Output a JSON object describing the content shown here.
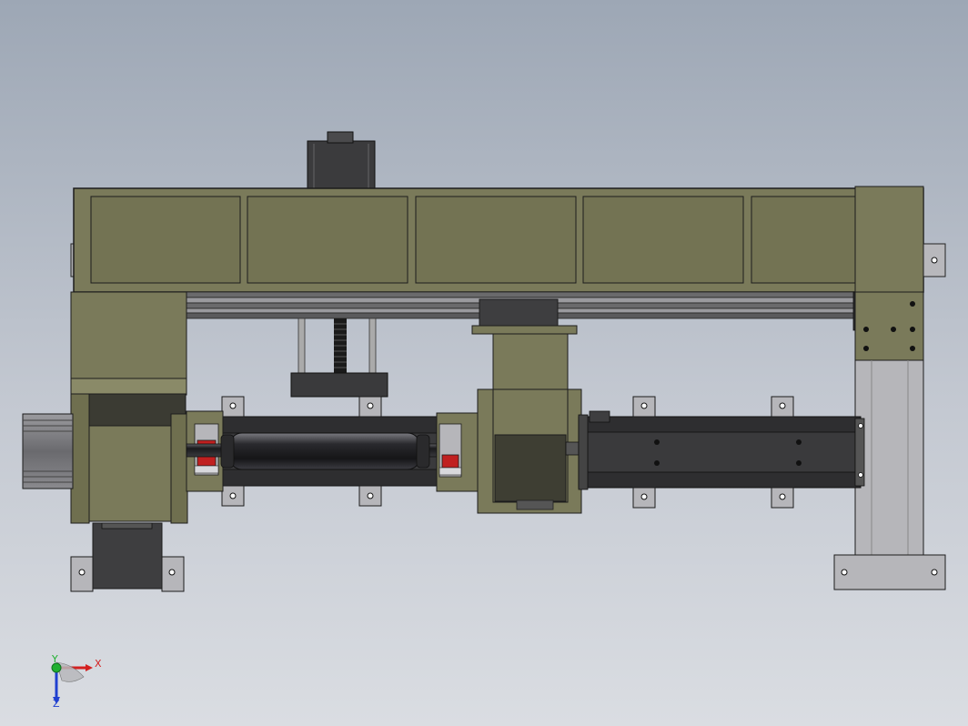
{
  "viewport": {
    "background_top": "#9da7b5",
    "background_bottom": "#dadde2"
  },
  "colors": {
    "olive_body": "#7c7c5c",
    "olive_panel": "#707050",
    "olive_light": "#8a8a68",
    "dark_steel": "#3a3a3c",
    "rail_black": "#2a2a2c",
    "silver_part": "#b8b8bc",
    "bearing_red": "#c02020",
    "outline": "#1c1c1c"
  },
  "orientation_triad": {
    "x_axis": {
      "label": "X",
      "color": "#d42020"
    },
    "y_axis": {
      "label": "Y",
      "color": "#20b030"
    },
    "z_axis": {
      "label": "Z",
      "color": "#2040d0"
    }
  }
}
